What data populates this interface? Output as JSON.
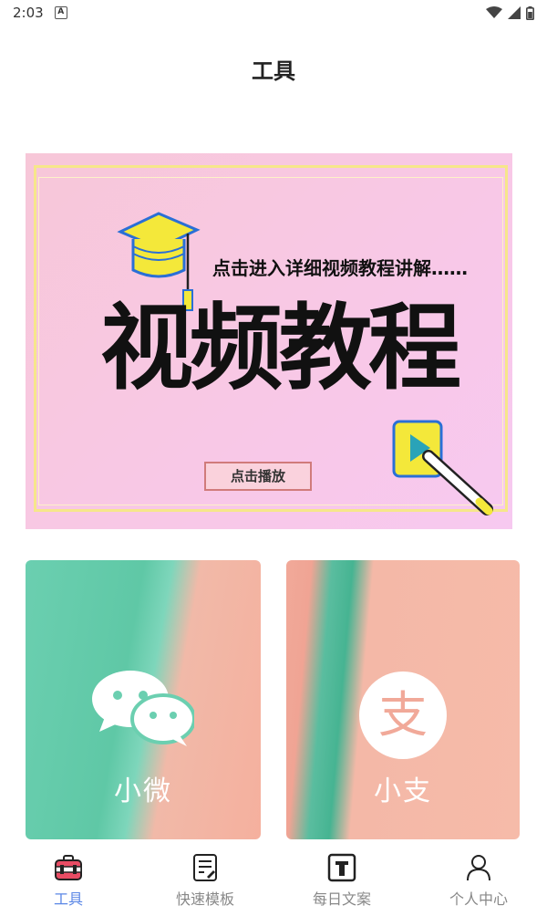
{
  "status": {
    "time": "2:03",
    "notif_icon": "a-badge-icon"
  },
  "header": {
    "title": "工具"
  },
  "banner": {
    "subtitle": "点击进入详细视频教程讲解……",
    "headline": "视频教程",
    "play_label": "点击播放"
  },
  "cards": [
    {
      "label": "小微",
      "icon": "wechat-icon"
    },
    {
      "label": "小支",
      "icon": "alipay-icon",
      "icon_char": "支"
    }
  ],
  "tabs": [
    {
      "label": "工具",
      "icon": "toolbox-icon",
      "active": true
    },
    {
      "label": "快速模板",
      "icon": "template-icon",
      "active": false
    },
    {
      "label": "每日文案",
      "icon": "text-icon",
      "active": false
    },
    {
      "label": "个人中心",
      "icon": "person-icon",
      "active": false
    }
  ],
  "colors": {
    "accent": "#5b87e6",
    "inactive": "#888888"
  }
}
